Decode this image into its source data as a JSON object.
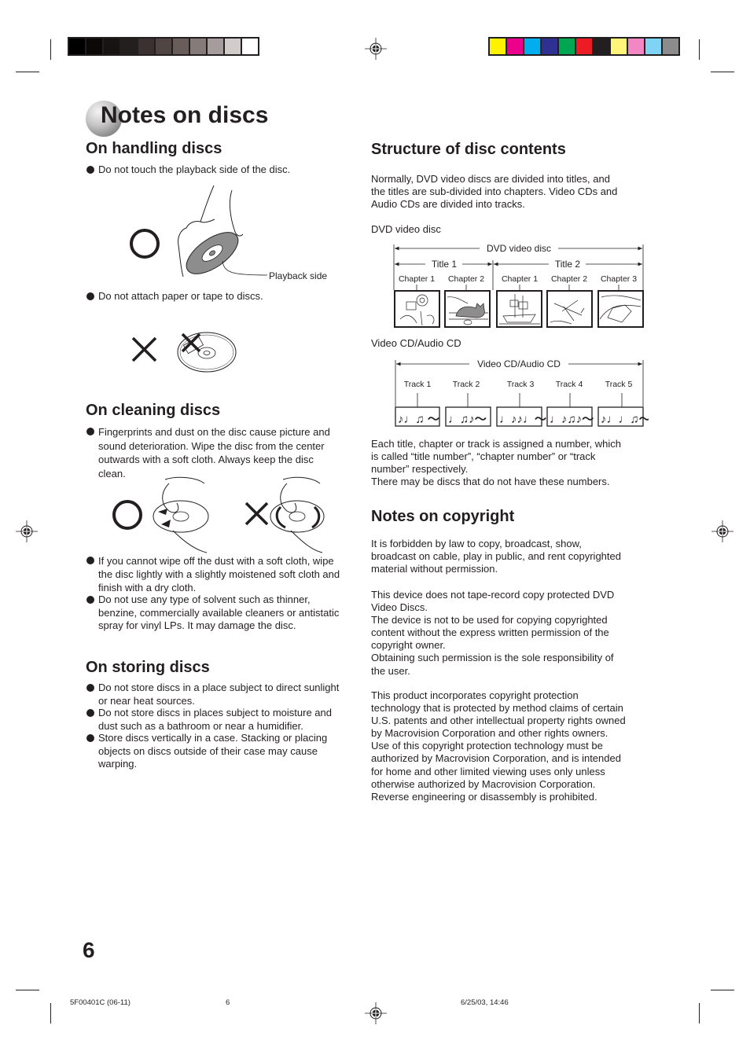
{
  "print_marks": {
    "grayscale_swatches": [
      "#000000",
      "#0b0908",
      "#161312",
      "#231f1d",
      "#3a3130",
      "#504543",
      "#685d5b",
      "#857b79",
      "#a59d9c",
      "#d1cbca",
      "#ffffff"
    ],
    "color_swatches": [
      "#fff200",
      "#ec008c",
      "#00aeef",
      "#2e3192",
      "#00a651",
      "#ed1c24",
      "#231f20",
      "#fff57a",
      "#f386c4",
      "#7fd4f6",
      "#8c8c8c"
    ]
  },
  "page_title": "Notes on discs",
  "handling": {
    "heading": "On handling discs",
    "bullet1": "Do not touch the playback side of the disc.",
    "playback_label": "Playback side",
    "bullet2": "Do not attach paper or tape to discs."
  },
  "cleaning": {
    "heading": "On cleaning discs",
    "bullet1_lines": [
      "Fingerprints and dust on the disc cause picture and",
      "sound deterioration. Wipe the disc from the center",
      "outwards with a soft cloth. Always keep the disc",
      "clean."
    ],
    "bullet2_lines": [
      "If you cannot wipe off the dust with a soft cloth, wipe",
      "the disc lightly with a slightly moistened soft cloth and",
      "finish with a dry cloth."
    ],
    "bullet3_lines": [
      "Do not use any type of solvent such as thinner,",
      "benzine, commercially available cleaners or antistatic",
      "spray for vinyl LPs. It may damage the disc."
    ]
  },
  "storing": {
    "heading": "On storing discs",
    "bullet1_lines": [
      "Do not store discs in a place subject to direct sunlight",
      "or near heat sources."
    ],
    "bullet2_lines": [
      "Do not store discs in places subject to moisture and",
      "dust such as a bathroom or near a humidifier."
    ],
    "bullet3_lines": [
      "Store discs vertically in a case. Stacking or placing",
      "objects on discs outside of their case may cause",
      "warping."
    ]
  },
  "structure": {
    "heading": "Structure of disc contents",
    "intro_lines": [
      "Normally, DVD video discs are divided into titles, and",
      "the titles are sub-divided into chapters. Video CDs and",
      "Audio CDs are divided into tracks."
    ],
    "dvd_label": "DVD video disc",
    "dvd_diagram": {
      "span_label": "DVD video disc",
      "titles": [
        {
          "label": "Title 1",
          "chapters": [
            "Chapter 1",
            "Chapter 2"
          ]
        },
        {
          "label": "Title 2",
          "chapters": [
            "Chapter 1",
            "Chapter 2",
            "Chapter 3"
          ]
        }
      ],
      "images": [
        "flower-camera-illustration",
        "cat-illustration",
        "sailing-ship-illustration",
        "airplane-illustration",
        "car-illustration"
      ]
    },
    "vcd_label": "Video CD/Audio CD",
    "vcd_diagram": {
      "span_label": "Video CD/Audio CD",
      "tracks": [
        "Track 1",
        "Track 2",
        "Track 3",
        "Track 4",
        "Track 5"
      ],
      "notes": [
        "♪♩♫ ～",
        "♩♫♪～",
        "♩♪♪♩～",
        "♩♪♫♪～",
        "♪♩♩♫～"
      ]
    },
    "numbers_lines": [
      "Each title, chapter or track is assigned a number, which",
      "is called “title number”, “chapter number” or “track",
      "number” respectively.",
      "There may be discs that do not have these numbers."
    ]
  },
  "copyright": {
    "heading": "Notes on copyright",
    "para1_lines": [
      "It is forbidden by law to copy, broadcast, show,",
      "broadcast on cable, play in public, and rent copyrighted",
      "material without permission."
    ],
    "para2_lines": [
      "This device does not tape-record copy protected DVD",
      "Video Discs.",
      "The device is not to be used for copying copyrighted",
      "content without the express written permission of the",
      "copyright owner.",
      "Obtaining such permission is the sole responsibility of",
      "the user."
    ],
    "para3_lines": [
      "This product incorporates copyright protection",
      "technology that is protected by method claims of certain",
      "U.S. patents and other intellectual property rights owned",
      "by Macrovision Corporation and other rights owners.",
      "Use of this copyright protection technology must be",
      "authorized by Macrovision Corporation, and is intended",
      "for home and other limited viewing uses only unless",
      "otherwise authorized by Macrovision Corporation.",
      "Reverse engineering or disassembly is prohibited."
    ]
  },
  "footer": {
    "page_number": "6",
    "doc_code": "5F00401C (06-11)",
    "sheet_number": "6",
    "timestamp": "6/25/03, 14:46"
  }
}
